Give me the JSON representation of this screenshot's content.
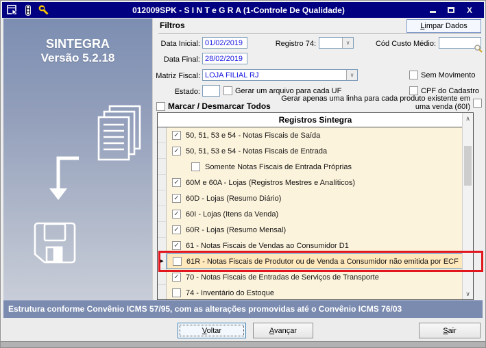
{
  "window": {
    "title": "012009SPK - S I N T e G R A (1-Controle De Qualidade)",
    "controls": [
      "minimize",
      "maximize",
      "close"
    ],
    "menu_icons": [
      "form-icon",
      "traffic-light-icon",
      "wrench-icon"
    ]
  },
  "sidebar": {
    "app_name": "SINTEGRA",
    "version": "Versão 5.2.18",
    "icons": [
      "documents-stack-icon",
      "down-arrow-icon",
      "floppy-disk-icon"
    ]
  },
  "filters": {
    "section_title": "Filtros",
    "clear_button": "Limpar Dados",
    "data_inicial": {
      "label": "Data Inicial:",
      "value": "01/02/2019"
    },
    "data_final": {
      "label": "Data Final:",
      "value": "28/02/2019"
    },
    "registro_74": {
      "label": "Registro 74:",
      "value": ""
    },
    "cod_custo_medio": {
      "label": "Cód Custo Médio:",
      "value": ""
    },
    "matriz_fiscal": {
      "label": "Matriz Fiscal:",
      "value": "LOJA FILIAL RJ"
    },
    "estado": {
      "label": "Estado:",
      "value": ""
    },
    "sem_movimento": {
      "label": "Sem Movimento",
      "checked": false
    },
    "gerar_arquivo_uf": {
      "label": "Gerar um arquivo para cada UF",
      "checked": false
    },
    "cpf_do_cadastro": {
      "label": "CPF do Cadastro",
      "checked": false
    },
    "marcar_todos": {
      "label": "Marcar / Desmarcar Todos",
      "checked": false
    },
    "linha_unica_60i": {
      "label": "Gerar apenas uma linha para cada produto existente em uma venda (60I)",
      "checked": false
    }
  },
  "grid": {
    "header": "Registros Sintegra",
    "rows": [
      {
        "label": "50, 51, 53 e 54 - Notas Fiscais de Saída",
        "checked": true,
        "indent": false,
        "highlighted": false
      },
      {
        "label": "50, 51, 53 e 54 - Notas Fiscais de Entrada",
        "checked": true,
        "indent": false,
        "highlighted": false
      },
      {
        "label": "Somente Notas Fiscais de Entrada Próprias",
        "checked": false,
        "indent": true,
        "highlighted": false
      },
      {
        "label": "60M e 60A - Lojas (Registros Mestres e Analíticos)",
        "checked": true,
        "indent": false,
        "highlighted": false
      },
      {
        "label": "60D - Lojas (Resumo Diário)",
        "checked": true,
        "indent": false,
        "highlighted": false
      },
      {
        "label": "60I - Lojas (Itens da Venda)",
        "checked": true,
        "indent": false,
        "highlighted": false
      },
      {
        "label": "60R - Lojas (Resumo Mensal)",
        "checked": true,
        "indent": false,
        "highlighted": false
      },
      {
        "label": "61 - Notas Fiscais de Vendas ao Consumidor D1",
        "checked": true,
        "indent": false,
        "highlighted": false
      },
      {
        "label": "61R - Notas Fiscais de Produtor ou de Venda a Consumidor não emitida por ECF",
        "checked": false,
        "indent": false,
        "highlighted": true
      },
      {
        "label": "70 - Notas Fiscais de Entradas de Serviços de Transporte",
        "checked": true,
        "indent": false,
        "highlighted": false
      },
      {
        "label": "74 - Inventário do Estoque",
        "checked": false,
        "indent": false,
        "highlighted": false
      }
    ]
  },
  "status_bar": {
    "text": "Estrutura conforme Convênio ICMS 57/95, com as alterações promovidas até o Convênio ICMS 76/03"
  },
  "footer": {
    "voltar": "Voltar",
    "avancar": "Avançar",
    "sair": "Sair"
  },
  "colors": {
    "title_bar": "#010080",
    "row_background": "#FCF3DC",
    "row_highlight": "#FFE8BC",
    "annotation_red": "#E2171E",
    "status_bar": "#7B8BAF",
    "field_value_blue": "#1515E0"
  }
}
